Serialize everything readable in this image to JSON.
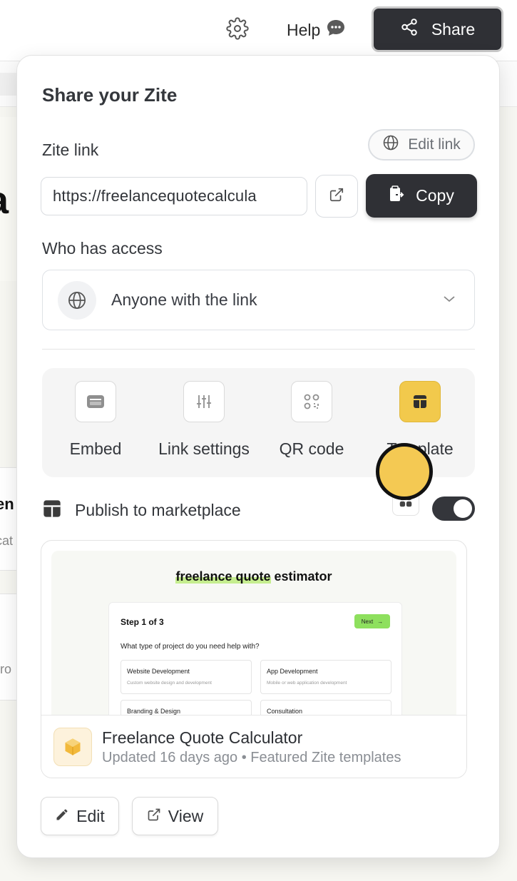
{
  "topbar": {
    "help_label": "Help",
    "share_label": "Share"
  },
  "share_popover": {
    "title": "Share your Zite",
    "zite_link_label": "Zite link",
    "edit_link_label": "Edit link",
    "url_value": "https://freelancequotecalcula",
    "copy_label": "Copy",
    "access_label": "Who has access",
    "access_value": "Anyone with the link",
    "tools": [
      {
        "label": "Embed",
        "icon": "embed-icon"
      },
      {
        "label": "Link settings",
        "icon": "sliders-icon"
      },
      {
        "label": "QR code",
        "icon": "qr-code-icon"
      },
      {
        "label": "Template",
        "icon": "template-icon"
      }
    ],
    "publish_label": "Publish to marketplace",
    "publish_enabled": true
  },
  "template_card": {
    "preview": {
      "title_highlight": "freelance quote",
      "title_rest": "estimator",
      "step": "Step 1 of 3",
      "next": "Next",
      "question": "What type of project do you need help with?",
      "options": [
        {
          "title": "Website Development",
          "desc": "Custom website design and development"
        },
        {
          "title": "App Development",
          "desc": "Mobile or web application development"
        },
        {
          "title": "Branding & Design",
          "desc": ""
        },
        {
          "title": "Consultation",
          "desc": ""
        }
      ]
    },
    "name": "Freelance Quote Calculator",
    "meta": "Updated 16 days ago • Featured Zite templates"
  },
  "actions": {
    "edit_label": "Edit",
    "view_label": "View"
  },
  "colors": {
    "dark_button": "#2f3035",
    "template_accent": "#f2c94c",
    "highlight_green": "#c6ee8f"
  }
}
